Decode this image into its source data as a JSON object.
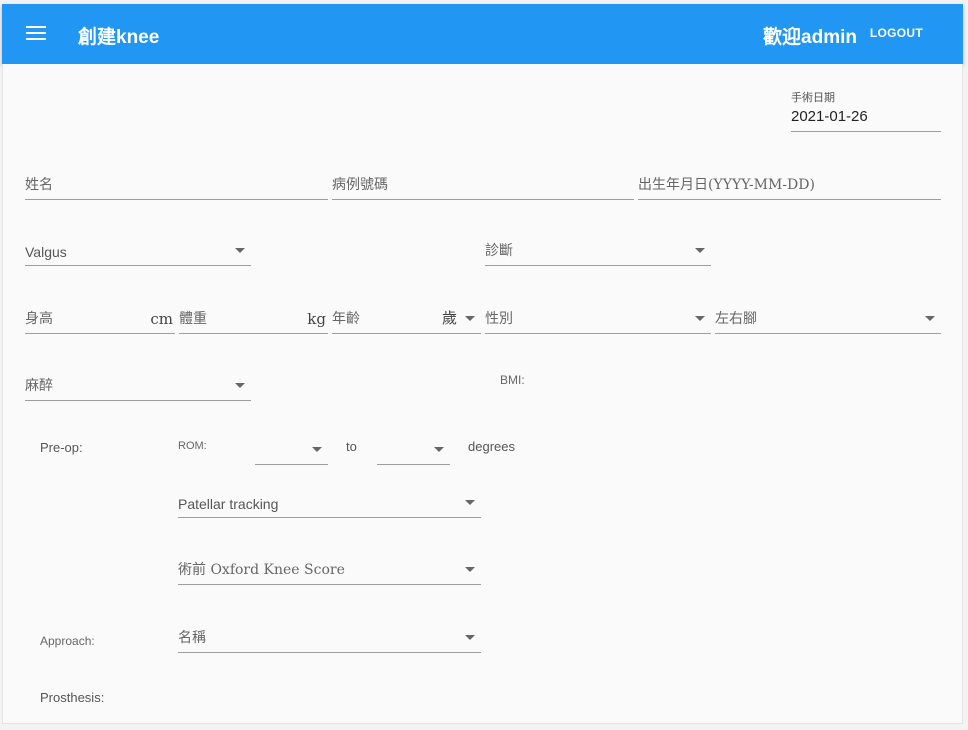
{
  "header": {
    "title": "創建knee",
    "welcome": "歡迎admin",
    "logout": "LOGOUT",
    "menu_icon": "hamburger-menu-icon",
    "bar_color": "#2196f3"
  },
  "form": {
    "surgery_date": {
      "label": "手術日期",
      "value": "2021-01-26"
    },
    "name": {
      "placeholder": "姓名"
    },
    "case_number": {
      "placeholder": "病例號碼"
    },
    "birthdate": {
      "placeholder": "出生年月日(YYYY-MM-DD)"
    },
    "deformity": {
      "value": "Valgus"
    },
    "diagnosis": {
      "placeholder": "診斷"
    },
    "height": {
      "placeholder": "身高",
      "unit": "cm"
    },
    "weight": {
      "placeholder": "體重",
      "unit": "kg"
    },
    "age": {
      "placeholder": "年齡",
      "unit": "歲"
    },
    "gender": {
      "placeholder": "性別"
    },
    "side": {
      "placeholder": "左右腳"
    },
    "anesthesia": {
      "placeholder": "麻醉"
    },
    "bmi_label": "BMI:",
    "preop": {
      "label": "Pre-op:",
      "rom_label": "ROM:",
      "to_label": "to",
      "degrees_label": "degrees",
      "patellar_tracking": {
        "placeholder": "Patellar tracking"
      },
      "oxford_score": {
        "placeholder": "術前 Oxford Knee Score"
      }
    },
    "approach": {
      "label": "Approach:",
      "placeholder": "名稱"
    },
    "prosthesis_label": "Prosthesis:"
  }
}
